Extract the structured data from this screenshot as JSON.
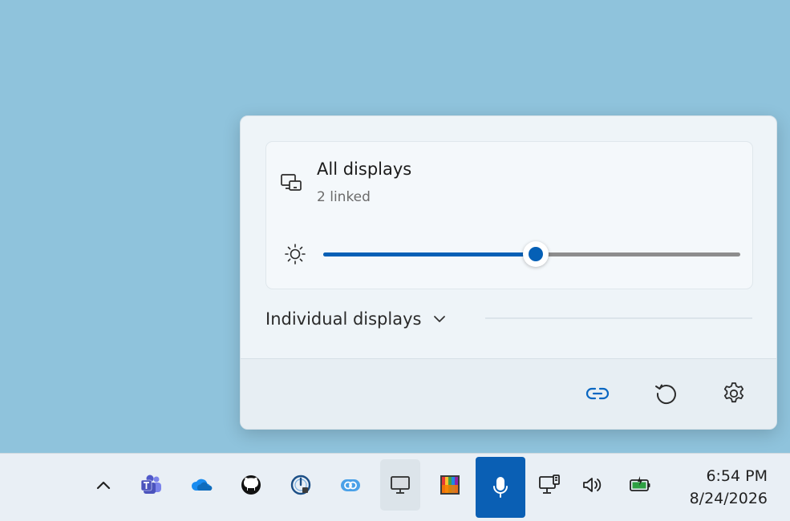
{
  "flyout": {
    "all_displays": {
      "title": "All displays",
      "subtitle": "2 linked",
      "icon": "linked-displays-icon"
    },
    "brightness": {
      "icon": "brightness-sun-icon",
      "value_percent": 51
    },
    "individual_displays": {
      "label": "Individual displays",
      "icon": "chevron-down-icon"
    },
    "footer_buttons": [
      {
        "name": "link-button",
        "icon": "link-icon",
        "color": "#0a67c2"
      },
      {
        "name": "reset-button",
        "icon": "refresh-icon"
      },
      {
        "name": "settings-button",
        "icon": "gear-icon"
      }
    ]
  },
  "taskbar": {
    "icons": [
      "chevron-up-icon",
      "teams-icon",
      "onedrive-icon",
      "github-icon",
      "speedometer-icon",
      "link-app-icon",
      "display-icon",
      "color-palette-icon",
      "microphone-icon",
      "network-icon",
      "volume-icon",
      "battery-icon"
    ],
    "active_icon": "display-icon",
    "highlighted_icon": "microphone-icon",
    "time": "6:54 PM",
    "date": "8/24/2026"
  },
  "colors": {
    "accent": "#0560b6",
    "desktop": "#8fc3dc",
    "flyout_bg": "#eef4f8"
  }
}
